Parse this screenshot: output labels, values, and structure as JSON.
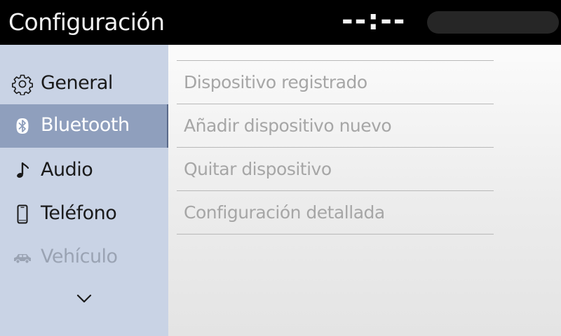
{
  "header": {
    "title": "Configuración",
    "clock": "--:--"
  },
  "sidebar": {
    "items": [
      {
        "label": "General",
        "icon": "gear-icon",
        "state": "normal"
      },
      {
        "label": "Bluetooth",
        "icon": "bluetooth-icon",
        "state": "selected"
      },
      {
        "label": "Audio",
        "icon": "music-note-icon",
        "state": "normal"
      },
      {
        "label": "Teléfono",
        "icon": "phone-icon",
        "state": "normal"
      },
      {
        "label": "Vehículo",
        "icon": "car-icon",
        "state": "disabled"
      }
    ],
    "more_icon": "chevron-down-icon"
  },
  "main": {
    "items": [
      {
        "label": "Dispositivo registrado"
      },
      {
        "label": "Añadir dispositivo nuevo"
      },
      {
        "label": "Quitar dispositivo"
      },
      {
        "label": "Configuración detallada"
      }
    ]
  },
  "colors": {
    "header_bg": "#000000",
    "sidebar_bg": "#c9d3e5",
    "sidebar_selected_bg": "#8f9fbd",
    "content_bg": "#f0f0f0",
    "list_text_disabled": "#a6a6a6"
  }
}
